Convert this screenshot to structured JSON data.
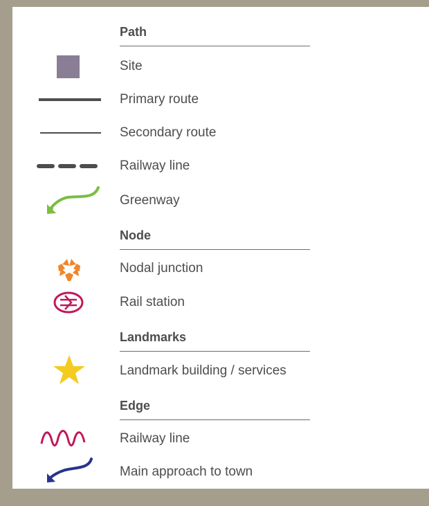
{
  "legend": {
    "sections": [
      {
        "heading": "Path",
        "items": [
          {
            "label": "Site",
            "icon": "site-square-icon",
            "color": "#8a7d96"
          },
          {
            "label": "Primary route",
            "icon": "primary-route-line-icon",
            "color": "#4d4d4d"
          },
          {
            "label": "Secondary route",
            "icon": "secondary-route-line-icon",
            "color": "#4d4d4d"
          },
          {
            "label": "Railway line",
            "icon": "railway-dashed-line-icon",
            "color": "#4d4d4d"
          },
          {
            "label": "Greenway",
            "icon": "greenway-arrow-icon",
            "color": "#7cbd42"
          }
        ]
      },
      {
        "heading": "Node",
        "items": [
          {
            "label": "Nodal junction",
            "icon": "nodal-junction-icon",
            "color": "#f0862a"
          },
          {
            "label": "Rail station",
            "icon": "rail-station-icon",
            "color": "#c0185a"
          }
        ]
      },
      {
        "heading": "Landmarks",
        "items": [
          {
            "label": "Landmark building / services",
            "icon": "star-icon",
            "color": "#f4cb1f"
          }
        ]
      },
      {
        "heading": "Edge",
        "items": [
          {
            "label": "Railway line",
            "icon": "railway-wave-icon",
            "color": "#c0185a"
          },
          {
            "label": "Main approach to town",
            "icon": "approach-arrow-icon",
            "color": "#27348b"
          }
        ]
      }
    ]
  }
}
